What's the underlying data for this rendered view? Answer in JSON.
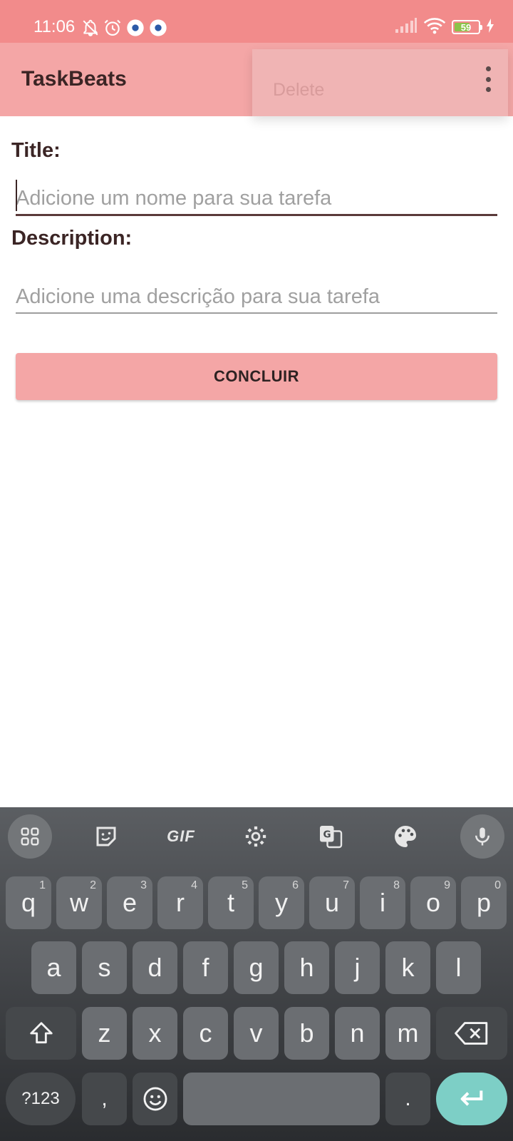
{
  "status_bar": {
    "time": "11:06",
    "battery": "59"
  },
  "app_bar": {
    "title": "TaskBeats"
  },
  "menu": {
    "items": [
      "Delete"
    ]
  },
  "form": {
    "title_label": "Title:",
    "title_placeholder": "Adicione um nome para sua tarefa",
    "description_label": "Description:",
    "description_placeholder": "Adicione uma descrição para sua tarefa",
    "submit_label": "CONCLUIR"
  },
  "keyboard": {
    "toolbar": {
      "gif_label": "GIF",
      "icons": [
        "apps-grid-icon",
        "sticker-icon",
        "gif-icon",
        "settings-icon",
        "translate-icon",
        "palette-icon",
        "mic-icon"
      ]
    },
    "row1": [
      {
        "key": "q",
        "hint": "1"
      },
      {
        "key": "w",
        "hint": "2"
      },
      {
        "key": "e",
        "hint": "3"
      },
      {
        "key": "r",
        "hint": "4"
      },
      {
        "key": "t",
        "hint": "5"
      },
      {
        "key": "y",
        "hint": "6"
      },
      {
        "key": "u",
        "hint": "7"
      },
      {
        "key": "i",
        "hint": "8"
      },
      {
        "key": "o",
        "hint": "9"
      },
      {
        "key": "p",
        "hint": "0"
      }
    ],
    "row2": [
      "a",
      "s",
      "d",
      "f",
      "g",
      "h",
      "j",
      "k",
      "l"
    ],
    "row3": [
      "z",
      "x",
      "c",
      "v",
      "b",
      "n",
      "m"
    ],
    "bottom": {
      "numbers": "?123",
      "comma": ",",
      "period": "."
    },
    "colors": {
      "enter": "#7dcfc6",
      "key": "#6b6e72",
      "background": "#3b3d40"
    }
  },
  "colors": {
    "status_bar": "#f28b8b",
    "app_bar": "#f4a6a6",
    "text": "#3b2525"
  }
}
